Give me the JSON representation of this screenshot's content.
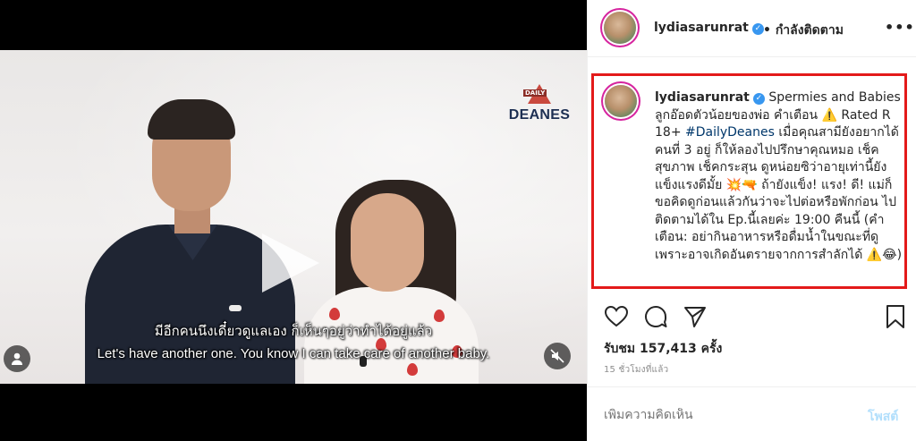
{
  "video": {
    "brand_name": "DEANES",
    "brand_badge": "DAILY",
    "subtitle_thai": "มีอีกคนนึงเดี๋ยวดูแลเอง ก็เห็นๆอยู่ว่าทำได้อยู่แล้ว",
    "subtitle_english": "Let's have another one. You know I can take care of another baby."
  },
  "header": {
    "username": "lydiasarunrat",
    "follow_text": "• กำลังติดตาม",
    "more_icon": "more-horizontal-icon"
  },
  "caption": {
    "username": "lydiasarunrat",
    "text_1": "Spermies and Babies ลูกอ๊อดตัวน้อยของพ่อ คำเตือน ⚠️ Rated R 18+ ",
    "hashtag": "#DailyDeanes",
    "text_2": " เมื่อคุณสามียังอยากได้คนที่ 3 อยู่ ก็ให้ลองไปปรึกษาคุณหมอ เช็คสุขภาพ เช็คกระสุน ดูหน่อยซิว่าอายุเท่านี้ยังแข็งแรงดีมั้ย 💥🔫 ถ้ายังแข็ง! แรง! ดี! แม่ก็ขอคิดดูก่อนแล้วกันว่าจะไปต่อหรือพักก่อน ไปติดตามได้ใน Ep.นี้เลยค่ะ 19:00 คืนนี้ (คำเตือน: อย่ากินอาหารหรือดื่มน้ำในขณะที่ดูเพราะอาจเกิดอันตรายจากการสำลักได้ ⚠️😂)"
  },
  "stats": {
    "views": "รับชม 157,413 ครั้ง",
    "time": "15 ชั่วโมงที่แล้ว"
  },
  "comment": {
    "placeholder": "เพิ่มความคิดเห็น",
    "post_label": "โพสต์"
  },
  "colors": {
    "highlight_border": "#e31a1a",
    "verified": "#3897f0",
    "hashtag": "#00376b",
    "post_disabled": "#b2dffc"
  }
}
